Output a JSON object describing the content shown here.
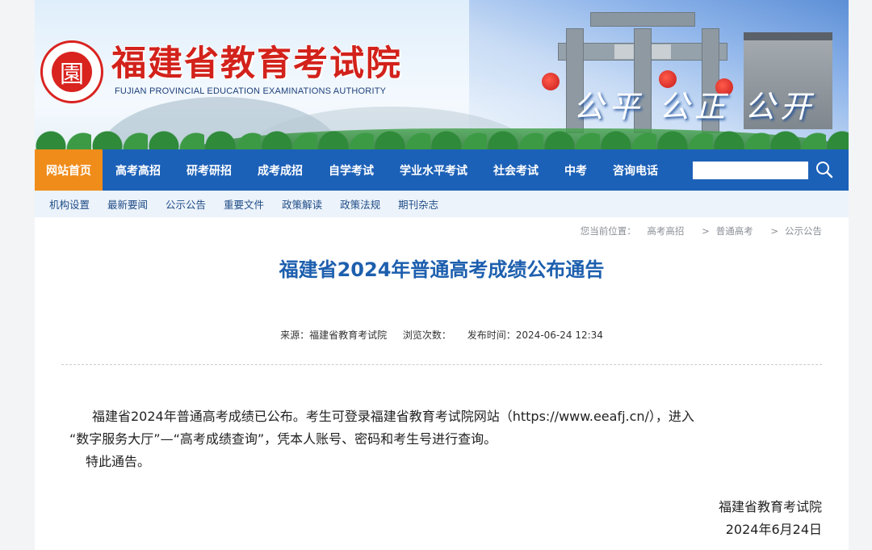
{
  "header": {
    "site_title": "福建省教育考试院",
    "site_subtitle": "FUJIAN PROVINCIAL EDUCATION EXAMINATIONS AUTHORITY",
    "slogan": "公平  公正  公开",
    "logo_glyph": "園"
  },
  "nav": {
    "items": [
      {
        "label": "网站首页",
        "active": true
      },
      {
        "label": "高考高招"
      },
      {
        "label": "研考研招"
      },
      {
        "label": "成考成招"
      },
      {
        "label": "自学考试"
      },
      {
        "label": "学业水平考试"
      },
      {
        "label": "社会考试"
      },
      {
        "label": "中考"
      },
      {
        "label": "咨询电话"
      }
    ],
    "search_value": ""
  },
  "subnav": {
    "items": [
      "机构设置",
      "最新要闻",
      "公示公告",
      "重要文件",
      "政策解读",
      "政策法规",
      "期刊杂志"
    ]
  },
  "breadcrumb": {
    "prefix": "您当前位置：",
    "items": [
      "高考高招",
      "普通高考",
      "公示公告"
    ],
    "separator": ">"
  },
  "article": {
    "title": "福建省2024年普通高考成绩公布通告",
    "meta": {
      "source_label": "来源：",
      "source": "福建省教育考试院",
      "views_label": "浏览次数：",
      "publish_label": "发布时间：",
      "publish_time": "2024-06-24 12:34"
    },
    "paragraph1_line1": "福建省2024年普通高考成绩已公布。考生可登录福建省教育考试院网站（https://www.eeafj.cn/），进入",
    "paragraph1_line2": "“数字服务大厅”—“高考成绩查询”，凭本人账号、密码和考生号进行查询。",
    "paragraph2": "特此通告。",
    "signature_org": "福建省教育考试院",
    "signature_date": "2024年6月24日"
  },
  "colors": {
    "nav_bg": "#1c61b8",
    "nav_active": "#f08c1a",
    "title_blue": "#1d5fae",
    "brand_red": "#d2221b"
  }
}
